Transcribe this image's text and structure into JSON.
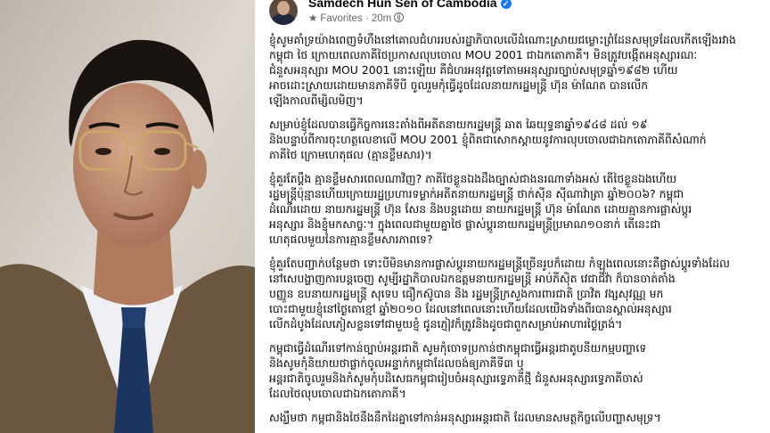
{
  "post": {
    "author": "Samdech Hun Sen of Cambodia",
    "audience": "Favorites",
    "separator": "·",
    "time": "20m",
    "paragraphs": [
      [
        "ខ្ញុំសូមគាំទ្រយ៉ាងពេញទំហឹងនៅគោលជំហររបស់រដ្ឋាភិបាលលើដំណោះស្រាយជម្លោះព្រំដែនសមុទ្រដែលកើតឡើងរវាង",
        "កម្ពុជា ថៃ ក្រោយពេលភាគីថៃប្រកាសលុបចោល MOU 2001 ជាឯកតោភាគី។ មិនត្រូវបង្កើតអនុស្សារណៈ",
        "ជំនួសអនុស្សារ MOU 2001 នោះឡើយ គឺជំហរអនុវត្តទៅតាមអនុស្សារច្បាប់សមុទ្រឆ្នាំ១៩៨២ ហើយ",
        "អាចដោះស្រាយដោយមានភាគីទីបី ចូលរួមកុំធ្វើដូចដែលនាយករដ្ឋមន្ត្រី ហ៊ុន ម៉ាណែត បានលើក",
        "ឡើងកាលពីម្សិលមិញ។"
      ],
      [
        "សម្រាប់ខ្ញុំដែលបានធ្វើកិច្ចការនេះតាំងពីអតីតនាយករដ្ឋមន្ត្រី ឆាត ឆៃយុទ្ធនាឆ្នាំ១៩៤៨ ដល់ ១៩",
        "និងបន្ទាប់ពីការចុះហត្ថលេខាលើ MOU 2001 ខ្ញុំពិតជាសោកស្ដាយនូវការលុបចោលជាឯកតោភាគីពីសំណាក់",
        "ភាគីថៃ ក្រោមហេតុផល (គ្មានខ្លឹមសារ)។"
      ],
      [
        "ខ្ញុំគួរតែប្ដឹង គ្មានខ្លឹមសារពេលណាវិញ? ភាគីថៃខ្លួនឯងដឹងច្បាស់ជាងនរណាទាំងអស់ តើថៃខ្លួនឯងហើយ",
        "រដ្ឋមន្ត្រីប៉ុន្មានហើយក្រោយរដ្ឋប្រហារទម្លាក់អតីតនាយករដ្ឋមន្ត្រី ថាក់ស៊ីន ស៊ីណាវ៉ាត្រា ឆ្នាំ២០០៦? កម្ពុជា",
        "ដំណើរដោយ នាយករដ្ឋមន្ត្រី ហ៊ុន សែន និងបន្តដោយ នាយករដ្ឋមន្ត្រី ហ៊ុន ម៉ាណែត ដោយគ្មានការផ្លាស់ប្ដូរ",
        "អនុស្សារ និងខ្ញុំមកសាច្ចៈ។ ក្នុងពេលជាមួយគ្នាថៃ ផ្លាស់ប្ដូរនាយករដ្ឋមន្ត្រីប្រមាណ១០នាក់ តើនេះជា",
        "ហេតុផលមួយនៃការគ្មានខ្លឹមសារភាពទេ?"
      ],
      [
        "ខ្ញុំគួរតែបញ្ជាក់បន្ថែមថា ទោះបីមិនមានការផ្លាស់ប្ដូរនាយករដ្ឋមន្ត្រីច្រើនរូបក៏ដោយ កំឡុងពេលនោះគឺផ្លាស់ប្ដូរទាំងដែល",
        "នៅសេបង្ហាញការបន្តចេញ សូម្បីរដ្ឋាភិបាលឯកឧត្តមនាយករដ្ឋមន្ត្រី អាប់ភីស៊ិត វេជាជីវ៉ា ក៏បានចាត់តាំង",
        "បញ្ញួន ឧបនាយករដ្ឋមន្ត្រី សុទេប ធឿកស៊ូបាន និង រដ្ឋមន្ត្រីក្រសួងការពារជាតិ ប្រាវិត វង្សសុវណ្ណ មក",
        "បោះជាមួយខ្ញុំនៅថ្ងៃតោខ្មៅ ឆ្នាំ២០១០ ដែលនៅពេលនោះហើយដែលយើងទាំងពីរបានស្គាល់អនុស្សារ",
        "លើកដំបូងដែលភៀសខ្លួនទៅជាមួយខ្ញុំ ជូនភ្ញៀវក៏ត្រូវនិងដូចជាពួកសម្រាប់អាហារថ្ងៃត្រង់។"
      ],
      [
        "កម្ពុជាធ្វើដំណើរទៅកាន់ច្បាប់អន្តរជាតិ សូមកុំចោទប្រកាន់ថាកម្ពុជាធ្វើអន្តរជាតូបនីយកម្មបញ្ហាទេ",
        "និងសូមកុំនិយាយថាផ្លាក់ចូលអន្ទាក់កម្ពុជាដែលចង់ឲ្យភាគីទី៣ ឬ",
        "អន្តរជាតិចូលរួមនិងកំសូមកុំបដិសេធកម្ពុជារៀបចំអនុស្សារទ្វេភាគីថ្មី ជំនួសអនុស្សារទ្វេភាគីចាស់",
        "ដែលថៃលុបចោលជាឯកតោភាគី។"
      ],
      [
        "សង្ឃឹមថា កម្ពុជានិងថៃនឹងនឹកដៃគ្នាទៅកាន់អនុស្សារអន្តរជាតិ ដែលមានសមត្ថកិច្ចលើបញ្ហាសមុទ្រ។"
      ]
    ]
  }
}
